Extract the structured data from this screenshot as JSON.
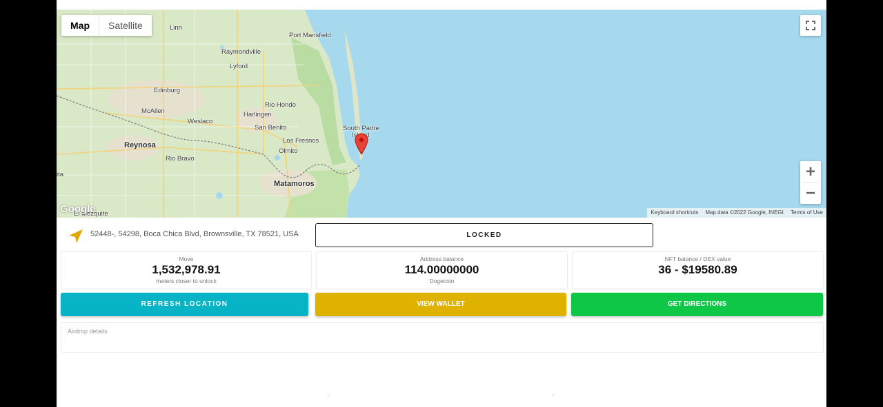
{
  "map": {
    "type_buttons": [
      "Map",
      "Satellite"
    ],
    "places": {
      "linn": "Linn",
      "port_mansfield": "Port Mansfield",
      "raymondville": "Raymondville",
      "lyford": "Lyford",
      "edinburg": "Edinburg",
      "rio_hondo": "Rio Hondo",
      "mcallen": "McAllen",
      "harlingen": "Harlingen",
      "weslaco": "Weslaco",
      "san_benito": "San Benito",
      "south_padre": "South Padre",
      "island": "Island",
      "reynosa": "Reynosa",
      "los_fresnos": "Los Fresnos",
      "olmito": "Olmito",
      "rio_bravo": "Rio Bravo",
      "ita": "ita",
      "matamoros": "Matamoros",
      "el_mezquite": "El Mezquite"
    },
    "google_logo": "Google",
    "attribution": {
      "keyboard": "Keyboard shortcuts",
      "map_data": "Map data ©2022 Google, INEGI",
      "terms": "Terms of Use"
    },
    "zoom_in": "+",
    "zoom_out": "−",
    "marker_color": "#ea4335",
    "water_color": "#a7d9ee"
  },
  "location": {
    "address": "52448-, 54298, Boca Chica Blvd, Brownsville, TX 78521, USA",
    "status": "LOCKED",
    "icon": "navigation-arrow-icon",
    "icon_color": "#e0a800"
  },
  "stats": [
    {
      "label": "Move",
      "value": "1,532,978.91",
      "sub": "meters closer to unlock"
    },
    {
      "label": "Address balance",
      "value": "114.00000000",
      "sub": "Dogecoin"
    },
    {
      "label": "NFT balance / DEX value",
      "value": "36 - $19580.89",
      "sub": ""
    }
  ],
  "buttons": {
    "refresh": "REFRESH LOCATION",
    "wallet": "VIEW WALLET",
    "directions": "GET DIRECTIONS"
  },
  "button_colors": {
    "refresh": "#06b4c6",
    "wallet": "#e0b200",
    "directions": "#0ec746"
  },
  "airdrop": {
    "placeholder": "Airdrop details"
  },
  "pager": {
    "prev": "‹",
    "next": "›"
  }
}
